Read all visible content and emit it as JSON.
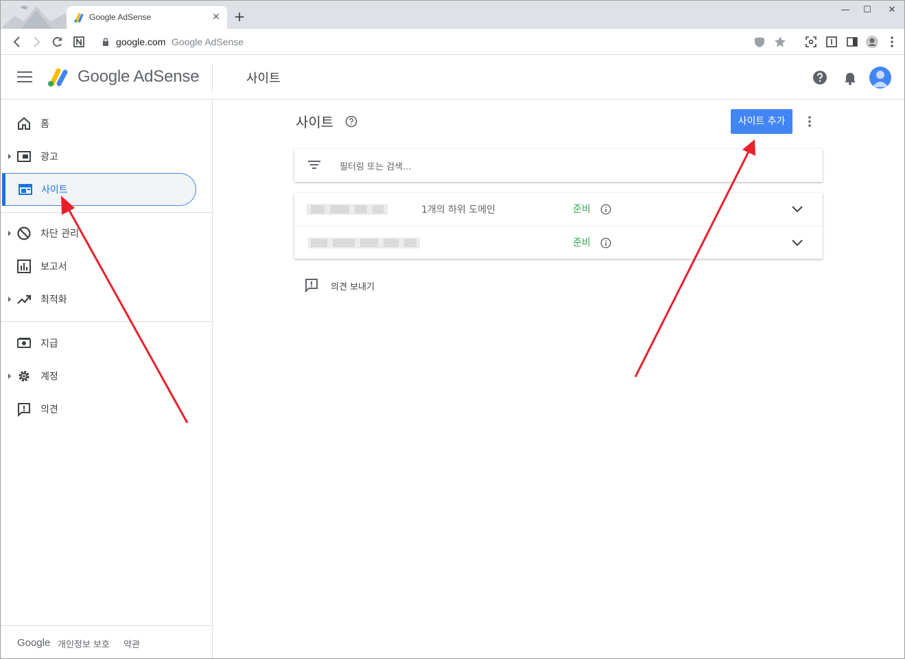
{
  "browser": {
    "tab_title": "Google AdSense",
    "tab_close": "✕",
    "new_tab": "+",
    "url_domain": "google.com",
    "url_title": "Google AdSense",
    "window_controls": [
      "—",
      "☐",
      "✕"
    ]
  },
  "header": {
    "logo_text": "Google AdSense",
    "page_title": "사이트",
    "icons": [
      "help-icon",
      "notifications-icon",
      "account-avatar"
    ]
  },
  "sidebar": {
    "items": [
      {
        "label": "홈",
        "icon": "home-icon",
        "expandable": false
      },
      {
        "label": "광고",
        "icon": "ads-icon",
        "expandable": true
      },
      {
        "label": "사이트",
        "icon": "sites-icon",
        "expandable": false,
        "active": true
      },
      {
        "label": "차단 관리",
        "icon": "block-icon",
        "expandable": true
      },
      {
        "label": "보고서",
        "icon": "reports-icon",
        "expandable": false
      },
      {
        "label": "최적화",
        "icon": "trending-icon",
        "expandable": true
      },
      {
        "label": "지급",
        "icon": "payments-icon",
        "expandable": false
      },
      {
        "label": "계정",
        "icon": "gear-icon",
        "expandable": true
      },
      {
        "label": "의견",
        "icon": "feedback-icon",
        "expandable": false
      }
    ],
    "footer": {
      "brand": "Google",
      "links": [
        "개인정보 보호",
        "약관"
      ]
    }
  },
  "main": {
    "title": "사이트",
    "add_button": "사이트 추가",
    "filter_placeholder": "필터링 또는 검색...",
    "sites": [
      {
        "subdomains": "1개의 하위 도메인",
        "status": "준비"
      },
      {
        "subdomains": "",
        "status": "준비"
      }
    ],
    "feedback_label": "의견 보내기"
  },
  "colors": {
    "accent": "#1a73e8",
    "button": "#4285f4",
    "status_ready": "#34a853",
    "annotation_arrow": "#e8202a"
  }
}
